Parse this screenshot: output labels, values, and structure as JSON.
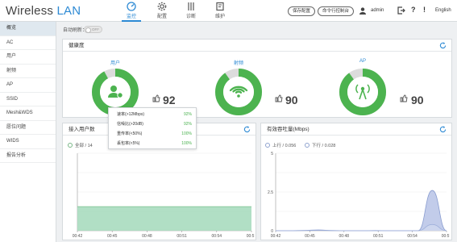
{
  "header": {
    "brand_a": "Wireless ",
    "brand_b": "LAN",
    "nav": [
      {
        "label": "监控",
        "icon": "monitor-icon"
      },
      {
        "label": "配置",
        "icon": "gear-icon"
      },
      {
        "label": "诊断",
        "icon": "diagnose-icon"
      },
      {
        "label": "维护",
        "icon": "maintenance-icon"
      }
    ],
    "save_label": "保存配置",
    "cli_label": "命令行控制台",
    "user": "admin",
    "lang": "English"
  },
  "sidebar": {
    "items": [
      "概览",
      "AC",
      "用户",
      "射频",
      "AP",
      "SSID",
      "Mesh&WDS",
      "愿位问题",
      "WIDS",
      "报告分析"
    ]
  },
  "auto_refresh": {
    "label": "自动刷新：",
    "toggle": "OFF"
  },
  "health": {
    "title": "健康度",
    "gauges": [
      {
        "label": "用户",
        "score": "92",
        "value": 92
      },
      {
        "label": "射频",
        "score": "90",
        "value": 90
      },
      {
        "label": "AP",
        "score": "90",
        "value": 90
      }
    ],
    "tooltip": [
      {
        "label": "速率(>12Mbps)",
        "value": "92%"
      },
      {
        "label": "信噪比(>20dB)",
        "value": "92%"
      },
      {
        "label": "重传率(<50%)",
        "value": "100%"
      },
      {
        "label": "丢包率(<5%)",
        "value": "100%"
      }
    ]
  },
  "colors": {
    "accent": "#2d8ad4",
    "gauge_green": "#4cb34f",
    "area_green": "#a9dbbf"
  },
  "users_panel": {
    "title": "接入用户数",
    "legend": "全部 / 14"
  },
  "throughput_panel": {
    "title": "有效吞吐量(Mbps)",
    "legend_up": "上行 / 0.056",
    "legend_down": "下行 / 0.028"
  },
  "chart_data": [
    {
      "type": "area",
      "x": [
        "00:42",
        "00:45",
        "00:48",
        "00:51",
        "00:54",
        "00:57"
      ],
      "series": [
        {
          "name": "全部",
          "values": [
            14,
            14,
            14,
            14,
            14,
            14
          ]
        }
      ],
      "ylim": [
        0,
        45
      ],
      "yticks": []
    },
    {
      "type": "area",
      "x": [
        "00:42",
        "00:45",
        "00:48",
        "00:51",
        "00:54",
        "00:57"
      ],
      "series": [
        {
          "name": "上行",
          "values": [
            0,
            0,
            0.02,
            0.05,
            0.01,
            0,
            0,
            0.01,
            0,
            0,
            0,
            2.6,
            0
          ]
        },
        {
          "name": "下行",
          "values": [
            0,
            0,
            0.01,
            0.02,
            0.01,
            0,
            0,
            0,
            0,
            0,
            0,
            0.4,
            0
          ]
        }
      ],
      "ylim": [
        0,
        5
      ],
      "yticks": [
        "0",
        "2.5",
        "5"
      ]
    }
  ]
}
